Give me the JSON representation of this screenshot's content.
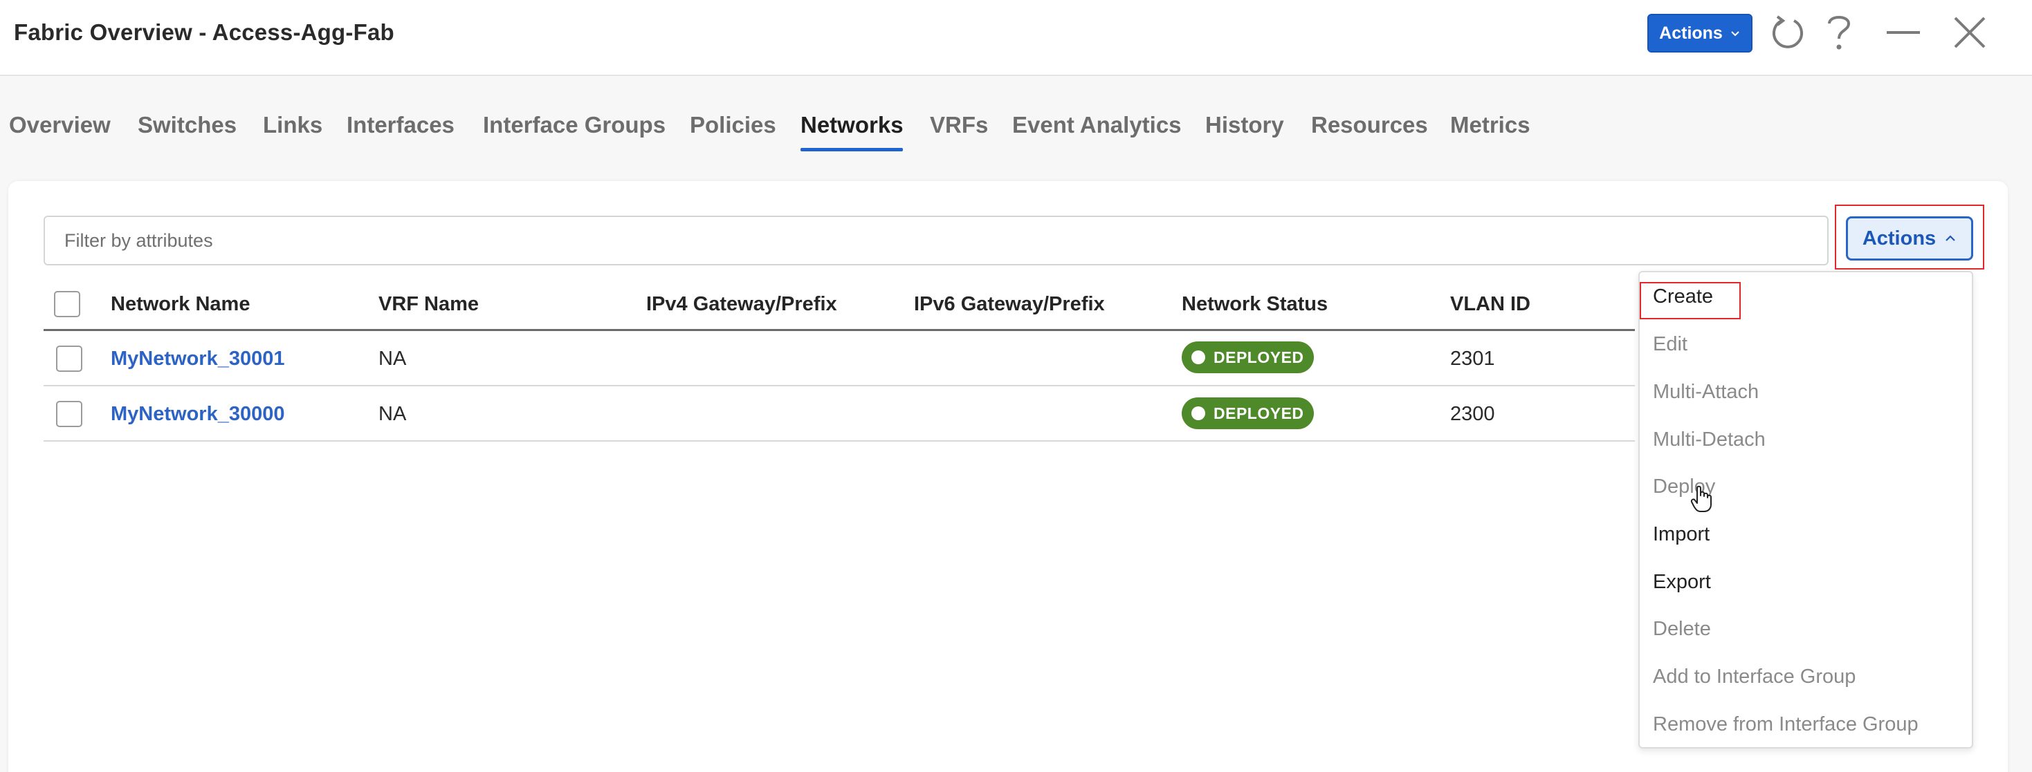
{
  "header": {
    "title": "Fabric Overview - Access-Agg-Fab",
    "actions_label": "Actions",
    "icons": [
      "refresh-icon",
      "help-icon",
      "minimize-icon",
      "close-icon"
    ]
  },
  "tabs": [
    {
      "label": "Overview",
      "active": false
    },
    {
      "label": "Switches",
      "active": false
    },
    {
      "label": "Links",
      "active": false
    },
    {
      "label": "Interfaces",
      "active": false
    },
    {
      "label": "Interface Groups",
      "active": false
    },
    {
      "label": "Policies",
      "active": false
    },
    {
      "label": "Networks",
      "active": true
    },
    {
      "label": "VRFs",
      "active": false
    },
    {
      "label": "Event Analytics",
      "active": false
    },
    {
      "label": "History",
      "active": false
    },
    {
      "label": "Resources",
      "active": false
    },
    {
      "label": "Metrics",
      "active": false
    }
  ],
  "toolbar": {
    "filter_placeholder": "Filter by attributes",
    "actions_label": "Actions"
  },
  "table": {
    "columns": [
      "Network Name",
      "VRF Name",
      "IPv4 Gateway/Prefix",
      "IPv6 Gateway/Prefix",
      "Network Status",
      "VLAN ID"
    ],
    "rows": [
      {
        "network_name": "MyNetwork_30001",
        "vrf_name": "NA",
        "ipv4": "",
        "ipv6": "",
        "status": "DEPLOYED",
        "vlan_id": "2301"
      },
      {
        "network_name": "MyNetwork_30000",
        "vrf_name": "NA",
        "ipv4": "",
        "ipv6": "",
        "status": "DEPLOYED",
        "vlan_id": "2300"
      }
    ]
  },
  "menu": {
    "items": [
      {
        "label": "Create",
        "enabled": true
      },
      {
        "label": "Edit",
        "enabled": false
      },
      {
        "label": "Multi-Attach",
        "enabled": false
      },
      {
        "label": "Multi-Detach",
        "enabled": false
      },
      {
        "label": "Deploy",
        "enabled": false
      },
      {
        "label": "Import",
        "enabled": true
      },
      {
        "label": "Export",
        "enabled": true
      },
      {
        "label": "Delete",
        "enabled": false
      },
      {
        "label": "Add to Interface Group",
        "enabled": false
      },
      {
        "label": "Remove from Interface Group",
        "enabled": false
      }
    ]
  },
  "colors": {
    "accent": "#1e64d0",
    "link": "#2c63c4",
    "status_deployed": "#4f8a2a",
    "highlight": "#e02a2a"
  }
}
